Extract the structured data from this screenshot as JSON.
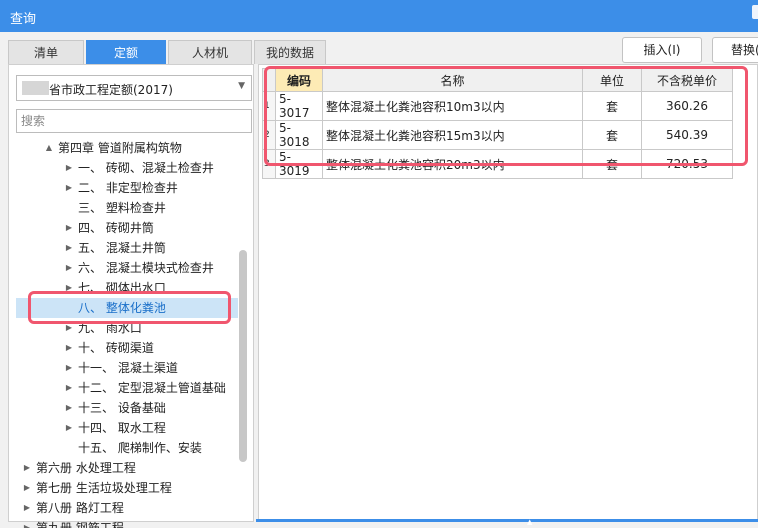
{
  "window": {
    "title": "查询"
  },
  "tabs": [
    {
      "label": "清单",
      "active": false
    },
    {
      "label": "定额",
      "active": true
    },
    {
      "label": "人材机",
      "active": false
    },
    {
      "label": "我的数据",
      "active": false
    }
  ],
  "buttons": {
    "insert": "插入(I)",
    "replace": "替换("
  },
  "library": {
    "selected": "省市政工程定额(2017)"
  },
  "search": {
    "placeholder": "搜索"
  },
  "tree": [
    {
      "label": "第四章 管道附属构筑物",
      "expanded": true
    },
    {
      "label": "一、 砖砌、混凝土检查井"
    },
    {
      "label": "二、 非定型检查井"
    },
    {
      "label": "三、 塑料检查井"
    },
    {
      "label": "四、 砖砌井筒"
    },
    {
      "label": "五、 混凝土井筒"
    },
    {
      "label": "六、 混凝土模块式检查井"
    },
    {
      "label": "七、 砌体出水口"
    },
    {
      "label": "八、 整体化粪池",
      "selected": true
    },
    {
      "label": "九、 雨水口"
    },
    {
      "label": "十、 砖砌渠道"
    },
    {
      "label": "十一、 混凝土渠道"
    },
    {
      "label": "十二、 定型混凝土管道基础"
    },
    {
      "label": "十三、 设备基础"
    },
    {
      "label": "十四、 取水工程"
    },
    {
      "label": "十五、 爬梯制作、安装"
    },
    {
      "label": "第六册 水处理工程"
    },
    {
      "label": "第七册 生活垃圾处理工程"
    },
    {
      "label": "第八册 路灯工程"
    },
    {
      "label": "第九册 钢筋工程"
    }
  ],
  "grid": {
    "headers": [
      "编码",
      "名称",
      "单位",
      "不含税单价"
    ],
    "rows": [
      {
        "index": "1",
        "code": "5-3017",
        "name": "整体混凝土化粪池容积10m3以内",
        "unit": "套",
        "price": "360.26"
      },
      {
        "index": "2",
        "code": "5-3018",
        "name": "整体混凝土化粪池容积15m3以内",
        "unit": "套",
        "price": "540.39"
      },
      {
        "index": "3",
        "code": "5-3019",
        "name": "整体混凝土化粪池容积20m3以内",
        "unit": "套",
        "price": "720.53"
      }
    ]
  },
  "colors": {
    "accent": "#3c8ee8",
    "highlight_box": "#f0566e",
    "selected_row": "#cce4f7"
  }
}
